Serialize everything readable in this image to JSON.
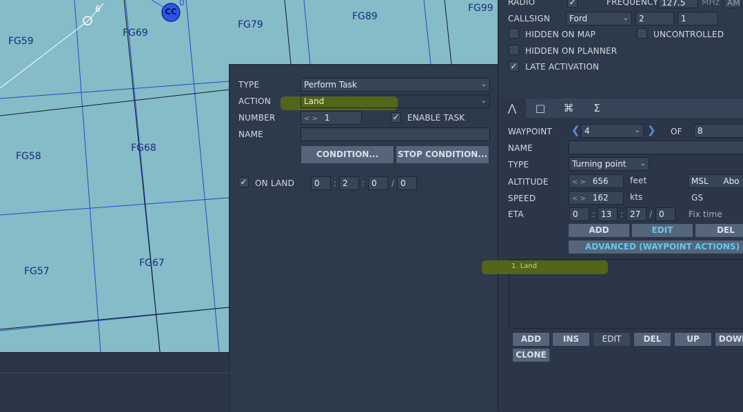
{
  "map": {
    "grid_labels": [
      "FG59",
      "FG69",
      "FG79",
      "FG89",
      "FG99",
      "FG58",
      "FG68",
      "FG57",
      "FG67"
    ],
    "marker_label": "CC",
    "route_numbers": [
      "6",
      "0"
    ]
  },
  "task_panel": {
    "type_label": "TYPE",
    "type_value": "Perform Task",
    "action_label": "ACTION",
    "action_value": "Land",
    "number_label": "NUMBER",
    "number_value": "1",
    "enable_task_label": "ENABLE TASK",
    "enable_task_checked": true,
    "name_label": "NAME",
    "name_value": "",
    "condition_button": "CONDITION...",
    "stop_condition_button": "STOP CONDITION...",
    "on_land_label": "ON LAND",
    "on_land_checked": true,
    "time": [
      "0",
      "2",
      "0",
      "0"
    ]
  },
  "right_panel": {
    "radio_label": "RADIO",
    "radio_checked": true,
    "frequency_label": "FREQUENCY",
    "frequency_value": "127.5",
    "frequency_unit": "MHz",
    "modulation": "AM",
    "callsign_label": "CALLSIGN",
    "callsign_name": "Ford",
    "callsign_num1": "2",
    "callsign_num2": "1",
    "hidden_on_map": "HIDDEN ON MAP",
    "uncontrolled": "UNCONTROLLED",
    "hidden_on_planner": "HIDDEN ON PLANNER",
    "late_activation": "LATE ACTIVATION",
    "late_activation_checked": true,
    "tabs": [
      "route-icon",
      "trigger-icon",
      "payload-icon",
      "summary-icon"
    ],
    "waypoint_label": "WAYPOINT",
    "waypoint_value": "4",
    "of_label": "OF",
    "of_value": "8",
    "name_label": "NAME",
    "name_value": "",
    "type_label": "TYPE",
    "type_value": "Turning point",
    "altitude_label": "ALTITUDE",
    "altitude_value": "656",
    "altitude_unit": "feet",
    "altitude_ref": "MSL",
    "altitude_ref2": "Abo",
    "speed_label": "SPEED",
    "speed_value": "162",
    "speed_unit": "kts",
    "speed_ref": "GS",
    "eta_label": "ETA",
    "eta": [
      "0",
      "13",
      "27",
      "0"
    ],
    "fix_time": "Fix time",
    "wp_add": "ADD",
    "wp_edit": "EDIT",
    "wp_del": "DEL",
    "advanced_button": "ADVANCED (WAYPOINT ACTIONS)",
    "task_list": [
      "1. Land"
    ],
    "list_add": "ADD",
    "list_ins": "INS",
    "list_edit": "EDIT",
    "list_del": "DEL",
    "list_up": "UP",
    "list_down": "DOWN",
    "list_clone": "CLONE"
  }
}
